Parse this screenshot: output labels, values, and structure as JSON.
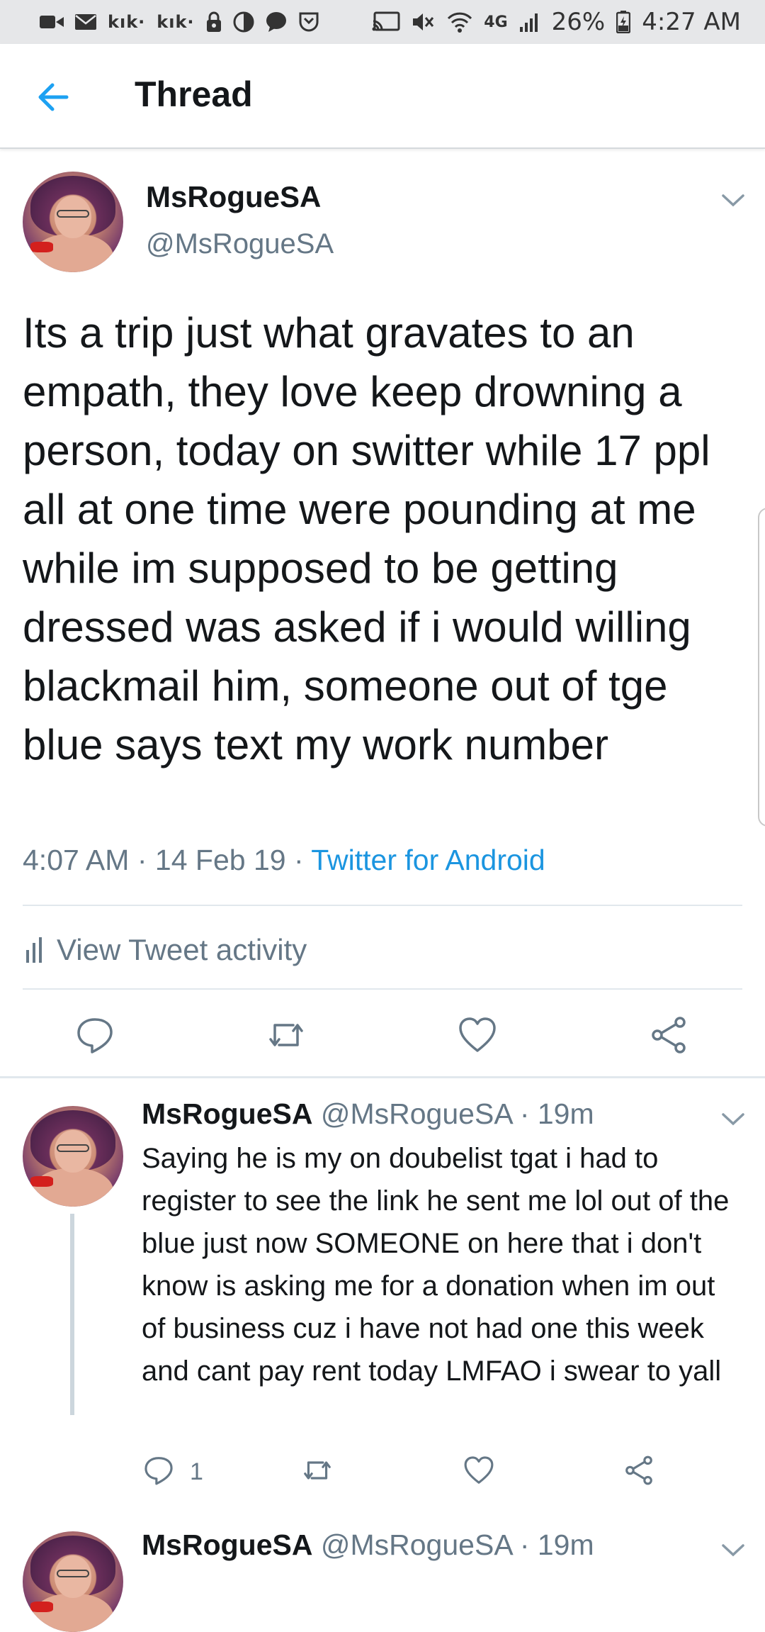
{
  "status_bar": {
    "kik_label_1": "kık·",
    "kik_label_2": "kık·",
    "network": "4G",
    "battery": "26%",
    "time": "4:27 AM"
  },
  "header": {
    "title": "Thread",
    "back_icon": "arrow-left-icon",
    "accent_color": "#1da1f2"
  },
  "main_tweet": {
    "name": "MsRogueSA",
    "handle": "@MsRogueSA",
    "text": "Its a trip just what gravates to an empath, they love keep drowning a person, today on switter while 17 ppl all at one time were pounding at me while im supposed to be getting dressed was asked if i would willing blackmail him, someone out of tge blue says text my work number",
    "time": "4:07 AM",
    "date": "14 Feb 19",
    "sep": "·",
    "source": "Twitter for Android",
    "activity_label": "View Tweet activity"
  },
  "replies": [
    {
      "name": "MsRogueSA",
      "handle": "@MsRogueSA",
      "age": "19m",
      "sep": "·",
      "text": "Saying he is my on doubelist tgat i had to register to see the link he sent me lol out of the blue just now SOMEONE on here that i don't know is asking me for a donation when im out of business cuz i have not had one this week and cant pay rent today LMFAO i swear to yall",
      "reply_count": "1"
    },
    {
      "name": "MsRogueSA",
      "handle": "@MsRogueSA",
      "age": "19m",
      "sep": "·"
    }
  ],
  "colors": {
    "text": "#14171a",
    "secondary": "#657786",
    "link": "#1b95e0",
    "divider": "#e1e8ed"
  }
}
